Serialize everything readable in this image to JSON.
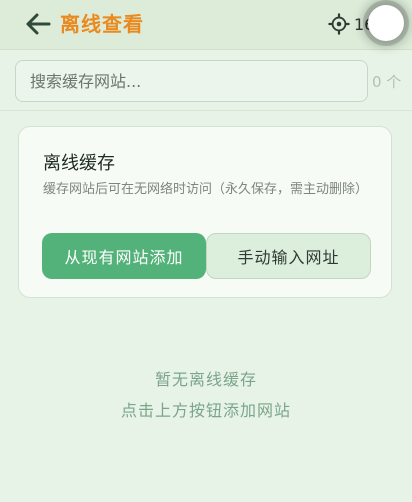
{
  "header": {
    "title": "离线查看",
    "back_icon": "arrow-left-icon",
    "settings_icon": "gear-icon",
    "count_text": "16"
  },
  "search": {
    "placeholder": "搜索缓存网站...",
    "value": "",
    "count_text": "0 个"
  },
  "card": {
    "title": "离线缓存",
    "description": "缓存网站后可在无网络时访问（永久保存，需主动删除）",
    "primary_button": "从现有网站添加",
    "secondary_button": "手动输入网址"
  },
  "empty_state": {
    "line1": "暂无离线缓存",
    "line2": "点击上方按钮添加网站"
  },
  "colors": {
    "accent_title": "#ea8a1e",
    "primary_green": "#52b279",
    "background": "#e8f3e7"
  }
}
